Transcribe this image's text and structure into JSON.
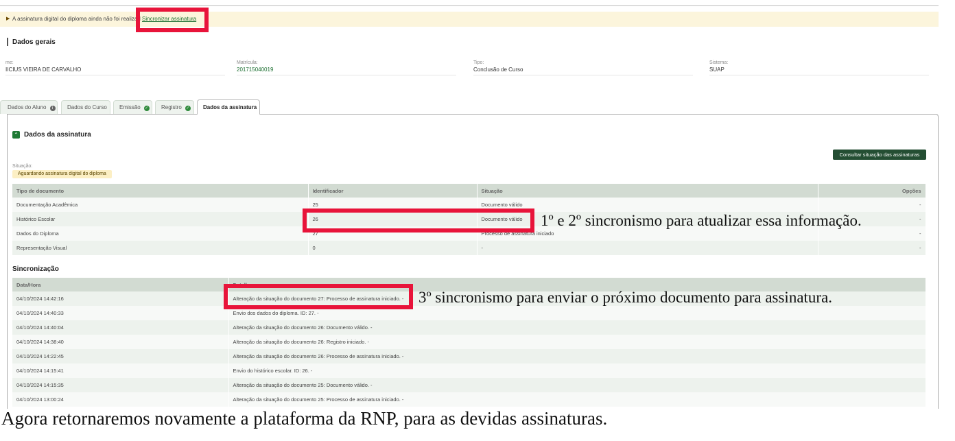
{
  "alert": {
    "message": "A assinatura digital do diploma ainda não foi realizad",
    "link": "Sincronizar assinatura",
    "suffix": "."
  },
  "general": {
    "title": "Dados gerais",
    "fields": [
      {
        "label": "me:",
        "value": "IICIUS VIEIRA DE CARVALHO"
      },
      {
        "label": "Matrícula:",
        "value": "201715040019"
      },
      {
        "label": "Tipo:",
        "value": "Conclusão de Curso"
      },
      {
        "label": "Sistema:",
        "value": "SUAP"
      }
    ]
  },
  "tabs": [
    {
      "label": "Dados do Aluno",
      "icon": "info-icon"
    },
    {
      "label": "Dados do Curso",
      "icon": ""
    },
    {
      "label": "Emissão",
      "icon": "check-icon"
    },
    {
      "label": "Registro",
      "icon": "check-icon"
    },
    {
      "label": "Dados da assinatura",
      "icon": ""
    }
  ],
  "signature": {
    "title": "Dados da assinatura",
    "consult_button": "Consultar situação das assinaturas",
    "status_label": "Situação:",
    "status_badge": "Aguardando assinatura digital do diploma",
    "doc_headers": [
      "Tipo de documento",
      "Identificador",
      "Situação",
      "Opções"
    ],
    "doc_rows": [
      [
        "Documentação Acadêmica",
        "25",
        "Documento válido",
        "-"
      ],
      [
        "Histórico Escolar",
        "26",
        "Documento válido",
        "-"
      ],
      [
        "Dados do Diploma",
        "27",
        "Processo de assinatura iniciado",
        "-"
      ],
      [
        "Representação Visual",
        "0",
        "-",
        "-"
      ]
    ],
    "sync_title": "Sincronização",
    "sync_headers": [
      "Data/Hora",
      "Detalhe"
    ],
    "sync_rows": [
      [
        "04/10/2024 14:42:16",
        "Alteração da situação do documento 27: Processo de assinatura iniciado. -"
      ],
      [
        "04/10/2024 14:40:33",
        "Envio dos dados do diploma. ID: 27. -"
      ],
      [
        "04/10/2024 14:40:04",
        "Alteração da situação do documento 26: Documento válido. -"
      ],
      [
        "04/10/2024 14:38:40",
        "Alteração da situação do documento 26: Registro iniciado. -"
      ],
      [
        "04/10/2024 14:22:45",
        "Alteração da situação do documento 26: Processo de assinatura iniciado. -"
      ],
      [
        "04/10/2024 14:15:41",
        "Envio do histórico escolar. ID: 26. -"
      ],
      [
        "04/10/2024 14:15:35",
        "Alteração da situação do documento 25: Documento válido. -"
      ],
      [
        "04/10/2024 13:00:24",
        "Alteração da situação do documento 25: Processo de assinatura iniciado. -"
      ]
    ]
  },
  "annotations": {
    "first": "1º e 2º sincronismo para atualizar essa informação.",
    "second": "3º sincronismo para enviar o próximo documento para assinatura.",
    "caption": "Agora retornaremos novamente a plataforma da RNP, para as devidas assinaturas."
  },
  "colors": {
    "highlight": "#e8143a",
    "accent": "#1f7a35",
    "alert_bg": "#fcf5dc"
  }
}
